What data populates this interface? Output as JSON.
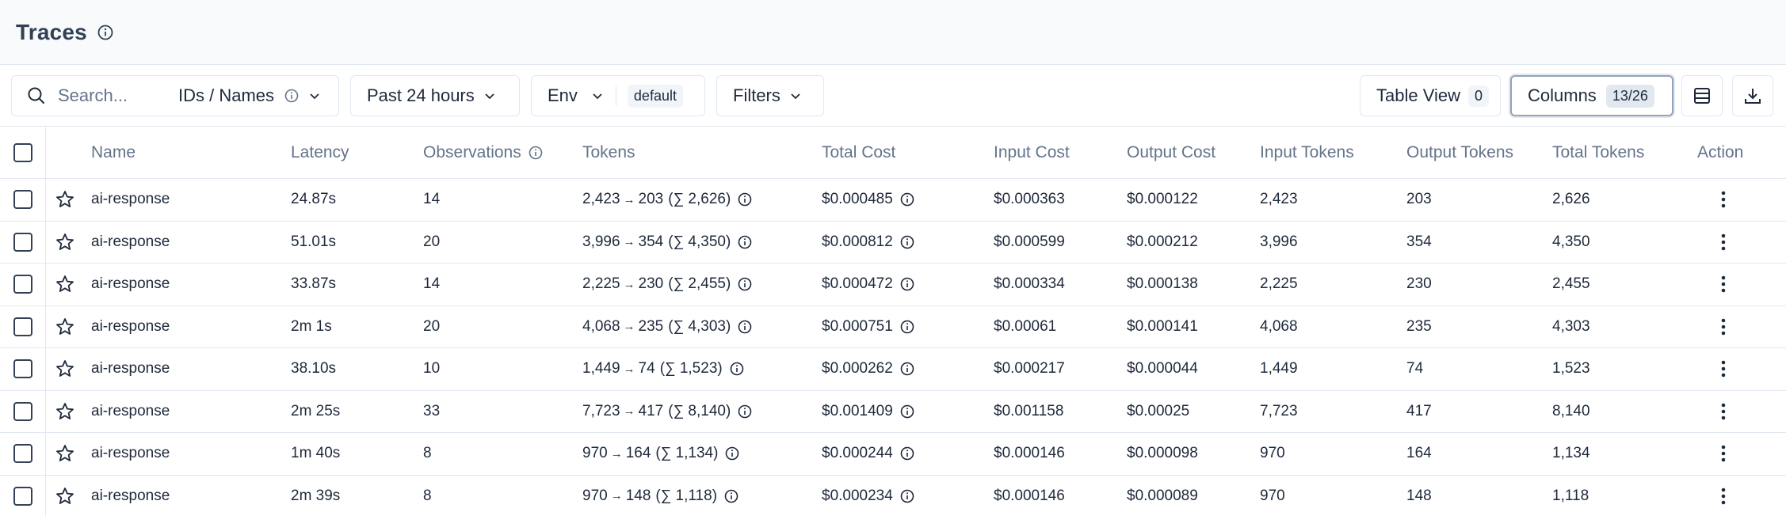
{
  "header": {
    "title": "Traces"
  },
  "toolbar": {
    "search_placeholder": "Search...",
    "search_mode": "IDs / Names",
    "time_range": "Past 24 hours",
    "env_label": "Env",
    "env_value": "default",
    "filters_label": "Filters",
    "table_view_label": "Table View",
    "table_view_count": "0",
    "columns_label": "Columns",
    "columns_count": "13/26"
  },
  "table": {
    "headers": {
      "name": "Name",
      "latency": "Latency",
      "observations": "Observations",
      "tokens": "Tokens",
      "total_cost": "Total Cost",
      "input_cost": "Input Cost",
      "output_cost": "Output Cost",
      "input_tokens": "Input Tokens",
      "output_tokens": "Output Tokens",
      "total_tokens": "Total Tokens",
      "action": "Action"
    },
    "rows": [
      {
        "name": "ai-response",
        "latency": "24.87s",
        "observations": "14",
        "tokens_in": "2,423",
        "tokens_out": "203",
        "tokens_sum": "(∑ 2,626)",
        "total_cost": "$0.000485",
        "input_cost": "$0.000363",
        "output_cost": "$0.000122",
        "input_tokens": "2,423",
        "output_tokens": "203",
        "total_tokens": "2,626"
      },
      {
        "name": "ai-response",
        "latency": "51.01s",
        "observations": "20",
        "tokens_in": "3,996",
        "tokens_out": "354",
        "tokens_sum": "(∑ 4,350)",
        "total_cost": "$0.000812",
        "input_cost": "$0.000599",
        "output_cost": "$0.000212",
        "input_tokens": "3,996",
        "output_tokens": "354",
        "total_tokens": "4,350"
      },
      {
        "name": "ai-response",
        "latency": "33.87s",
        "observations": "14",
        "tokens_in": "2,225",
        "tokens_out": "230",
        "tokens_sum": "(∑ 2,455)",
        "total_cost": "$0.000472",
        "input_cost": "$0.000334",
        "output_cost": "$0.000138",
        "input_tokens": "2,225",
        "output_tokens": "230",
        "total_tokens": "2,455"
      },
      {
        "name": "ai-response",
        "latency": "2m 1s",
        "observations": "20",
        "tokens_in": "4,068",
        "tokens_out": "235",
        "tokens_sum": "(∑ 4,303)",
        "total_cost": "$0.000751",
        "input_cost": "$0.00061",
        "output_cost": "$0.000141",
        "input_tokens": "4,068",
        "output_tokens": "235",
        "total_tokens": "4,303"
      },
      {
        "name": "ai-response",
        "latency": "38.10s",
        "observations": "10",
        "tokens_in": "1,449",
        "tokens_out": "74",
        "tokens_sum": "(∑ 1,523)",
        "total_cost": "$0.000262",
        "input_cost": "$0.000217",
        "output_cost": "$0.000044",
        "input_tokens": "1,449",
        "output_tokens": "74",
        "total_tokens": "1,523"
      },
      {
        "name": "ai-response",
        "latency": "2m 25s",
        "observations": "33",
        "tokens_in": "7,723",
        "tokens_out": "417",
        "tokens_sum": "(∑ 8,140)",
        "total_cost": "$0.001409",
        "input_cost": "$0.001158",
        "output_cost": "$0.00025",
        "input_tokens": "7,723",
        "output_tokens": "417",
        "total_tokens": "8,140"
      },
      {
        "name": "ai-response",
        "latency": "1m 40s",
        "observations": "8",
        "tokens_in": "970",
        "tokens_out": "164",
        "tokens_sum": "(∑ 1,134)",
        "total_cost": "$0.000244",
        "input_cost": "$0.000146",
        "output_cost": "$0.000098",
        "input_tokens": "970",
        "output_tokens": "164",
        "total_tokens": "1,134"
      },
      {
        "name": "ai-response",
        "latency": "2m 39s",
        "observations": "8",
        "tokens_in": "970",
        "tokens_out": "148",
        "tokens_sum": "(∑ 1,118)",
        "total_cost": "$0.000234",
        "input_cost": "$0.000146",
        "output_cost": "$0.000089",
        "input_tokens": "970",
        "output_tokens": "148",
        "total_tokens": "1,118"
      }
    ]
  },
  "icons": {
    "info": "info-icon",
    "search": "search-icon",
    "chevron": "chevron-down-icon",
    "star": "star-icon",
    "more": "more-vertical-icon",
    "density": "row-density-icon",
    "download": "download-icon",
    "arrow": "→"
  }
}
